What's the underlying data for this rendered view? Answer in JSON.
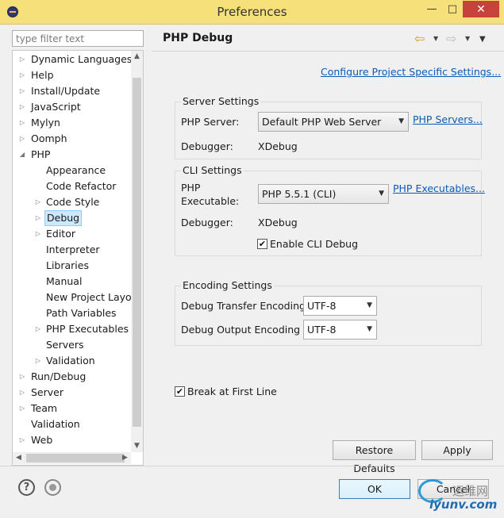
{
  "window": {
    "title": "Preferences",
    "min_glyph": "—",
    "max_glyph": "□",
    "close_glyph": "✕"
  },
  "filter": {
    "placeholder": "type filter text",
    "value": ""
  },
  "tree": {
    "items": [
      {
        "label": "Dynamic Languages",
        "expander": "▷"
      },
      {
        "label": "Help",
        "expander": "▷"
      },
      {
        "label": "Install/Update",
        "expander": "▷"
      },
      {
        "label": "JavaScript",
        "expander": "▷"
      },
      {
        "label": "Mylyn",
        "expander": "▷"
      },
      {
        "label": "Oomph",
        "expander": "▷"
      },
      {
        "label": "PHP",
        "expander": "◢"
      },
      {
        "label": "Appearance",
        "expander": ""
      },
      {
        "label": "Code Refactor",
        "expander": ""
      },
      {
        "label": "Code Style",
        "expander": "▷"
      },
      {
        "label": "Debug",
        "expander": "▷",
        "selected": true
      },
      {
        "label": "Editor",
        "expander": "▷"
      },
      {
        "label": "Interpreter",
        "expander": ""
      },
      {
        "label": "Libraries",
        "expander": ""
      },
      {
        "label": "Manual",
        "expander": ""
      },
      {
        "label": "New Project Layou",
        "expander": ""
      },
      {
        "label": "Path Variables",
        "expander": ""
      },
      {
        "label": "PHP Executables",
        "expander": "▷"
      },
      {
        "label": "Servers",
        "expander": ""
      },
      {
        "label": "Validation",
        "expander": "▷"
      },
      {
        "label": "Run/Debug",
        "expander": "▷"
      },
      {
        "label": "Server",
        "expander": "▷"
      },
      {
        "label": "Team",
        "expander": "▷"
      },
      {
        "label": "Validation",
        "expander": ""
      },
      {
        "label": "Web",
        "expander": "▷"
      }
    ],
    "scroll_up": "▲",
    "scroll_down": "▼",
    "scroll_left": "◀",
    "scroll_right": "▶"
  },
  "page": {
    "title": "PHP Debug",
    "nav_back": "⇦",
    "nav_forward": "⇨",
    "dropdown_glyph": "▼",
    "configure_link": "Configure Project Specific Settings...",
    "server_settings": {
      "title": "Server Settings",
      "server_label": "PHP Server:",
      "server_value": "Default PHP Web Server",
      "servers_link": "PHP Servers...",
      "debugger_label": "Debugger:",
      "debugger_value": "XDebug"
    },
    "cli_settings": {
      "title": "CLI Settings",
      "exec_label_1": "PHP",
      "exec_label_2": "Executable:",
      "exec_value": "PHP 5.5.1 (CLI)",
      "executables_link": "PHP Executables...",
      "debugger_label": "Debugger:",
      "debugger_value": "XDebug",
      "enable_cli_label": "Enable CLI Debug",
      "enable_cli_checked": true
    },
    "encoding_settings": {
      "title": "Encoding Settings",
      "transfer_label": "Debug Transfer Encoding",
      "transfer_value": "UTF-8",
      "output_label": "Debug Output Encoding",
      "output_value": "UTF-8"
    },
    "break_first_line_label": "Break at First Line",
    "break_first_line_checked": true,
    "check_glyph": "✔",
    "restore_label": "Restore Defaults",
    "apply_label": "Apply"
  },
  "footer": {
    "help_glyph": "?",
    "ok_label": "OK",
    "cancel_label": "Cancel"
  },
  "watermark": {
    "cn": "运维网",
    "url": "iyunv.com"
  }
}
